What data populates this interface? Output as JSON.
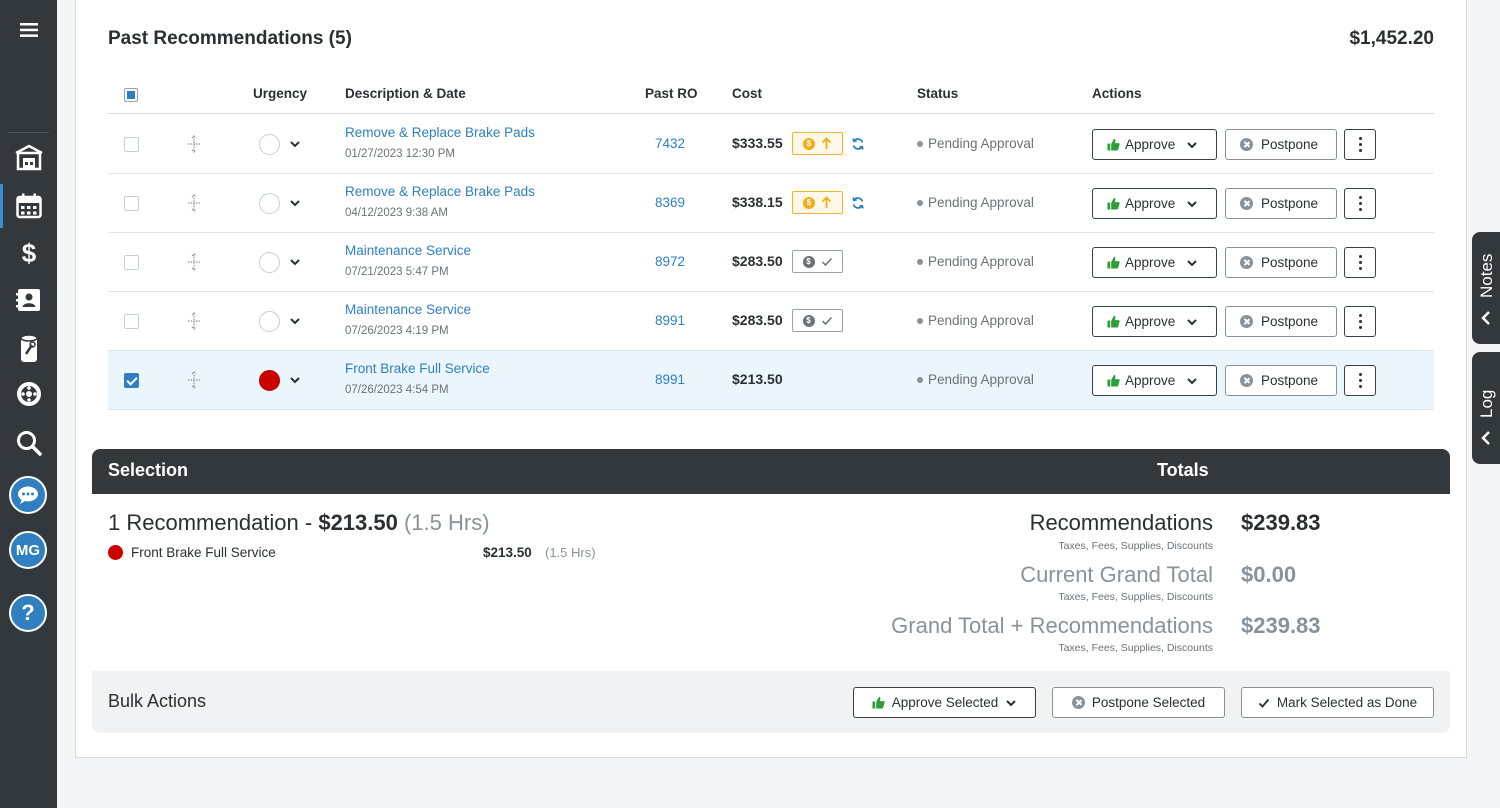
{
  "sidebar": {
    "menu_icon": "hamburger-icon",
    "items": [
      {
        "icon": "shop-icon"
      },
      {
        "icon": "calendar-icon",
        "active": true
      },
      {
        "icon": "dollar-icon"
      },
      {
        "icon": "contacts-icon"
      },
      {
        "icon": "parts-icon"
      },
      {
        "icon": "tire-icon"
      },
      {
        "icon": "search-icon"
      },
      {
        "icon": "chat-icon"
      }
    ],
    "avatar_initials": "MG",
    "help_label": "?"
  },
  "header": {
    "title": "Past Recommendations (5)",
    "total": "$1,452.20"
  },
  "table": {
    "columns": {
      "urgency": "Urgency",
      "description": "Description & Date",
      "past_ro": "Past RO",
      "cost": "Cost",
      "status": "Status",
      "actions": "Actions"
    },
    "rows": [
      {
        "checked": false,
        "urgency": "none",
        "description": "Remove & Replace Brake Pads",
        "date": "01/27/2023 12:30 PM",
        "ro": "7432",
        "cost": "$333.55",
        "price_badge": "increase",
        "status": "Pending Approval"
      },
      {
        "checked": false,
        "urgency": "none",
        "description": "Remove & Replace Brake Pads",
        "date": "04/12/2023 9:38 AM",
        "ro": "8369",
        "cost": "$338.15",
        "price_badge": "increase",
        "status": "Pending Approval"
      },
      {
        "checked": false,
        "urgency": "none",
        "description": "Maintenance Service",
        "date": "07/21/2023 5:47 PM",
        "ro": "8972",
        "cost": "$283.50",
        "price_badge": "unchanged",
        "status": "Pending Approval"
      },
      {
        "checked": false,
        "urgency": "none",
        "description": "Maintenance Service",
        "date": "07/26/2023 4:19 PM",
        "ro": "8991",
        "cost": "$283.50",
        "price_badge": "unchanged",
        "status": "Pending Approval"
      },
      {
        "checked": true,
        "urgency": "red",
        "description": "Front Brake Full Service",
        "date": "07/26/2023 4:54 PM",
        "ro": "8991",
        "cost": "$213.50",
        "price_badge": "none",
        "status": "Pending Approval"
      }
    ],
    "approve_label": "Approve",
    "postpone_label": "Postpone"
  },
  "selection": {
    "heading": "Selection",
    "summary_prefix": "1 Recommendation - ",
    "summary_amount": "$213.50",
    "summary_hours": "(1.5 Hrs)",
    "item": {
      "name": "Front Brake Full Service",
      "cost": "$213.50",
      "hours": "(1.5 Hrs)"
    }
  },
  "totals": {
    "heading": "Totals",
    "lines": [
      {
        "label": "Recommendations",
        "sub": "Taxes, Fees, Supplies, Discounts",
        "value": "$239.83",
        "emphasis": true
      },
      {
        "label": "Current Grand Total",
        "sub": "Taxes, Fees, Supplies, Discounts",
        "value": "$0.00",
        "emphasis": false
      },
      {
        "label": "Grand Total + Recommendations",
        "sub": "Taxes, Fees, Supplies, Discounts",
        "value": "$239.83",
        "emphasis": false
      }
    ]
  },
  "bulk": {
    "title": "Bulk Actions",
    "approve_selected": "Approve Selected",
    "postpone_selected": "Postpone Selected",
    "mark_done": "Mark Selected as Done"
  },
  "side_tabs": {
    "notes": "Notes",
    "log": "Log"
  },
  "colors": {
    "accent": "#2f7fc1",
    "dark": "#33383c",
    "approve_green": "#2e9e3a",
    "warning": "#f0ad1a",
    "urgent_red": "#cc0000"
  }
}
